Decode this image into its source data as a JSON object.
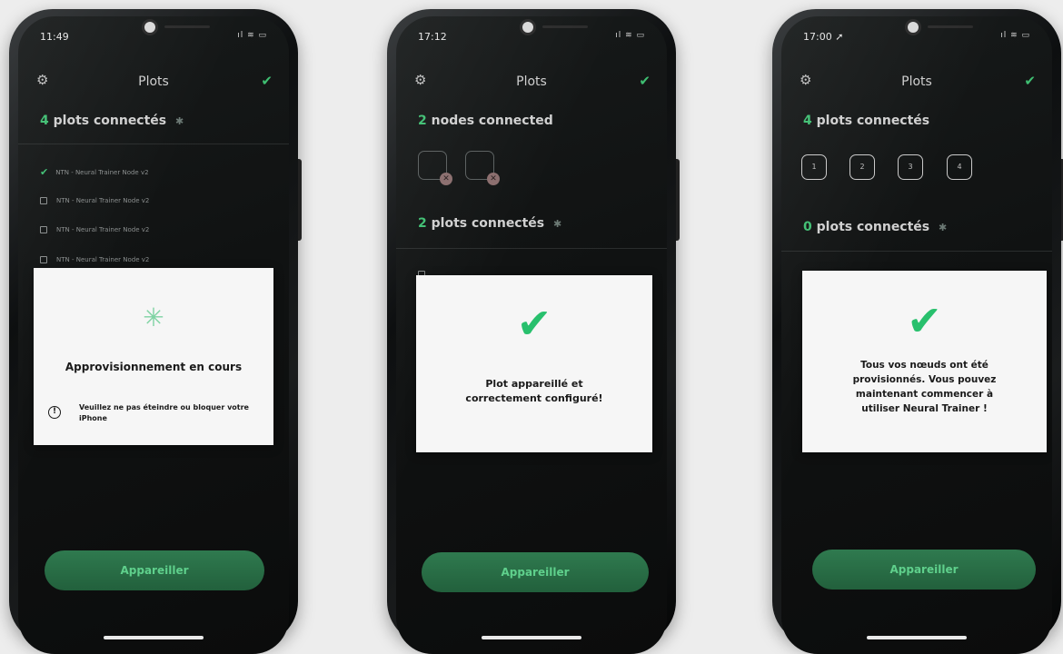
{
  "phones": [
    {
      "time": "11:49",
      "status_icons": "ıl ≋ ▭",
      "nav": {
        "title": "Plots"
      },
      "section1": {
        "count": "4",
        "label": "plots connectés"
      },
      "items": [
        "NTN - Neural Trainer Node v2",
        "NTN - Neural Trainer Node v2",
        "NTN - Neural Trainer Node v2",
        "NTN - Neural Trainer Node v2"
      ],
      "modal": {
        "title": "Approvisionnement en cours",
        "warning": "Veuillez ne pas éteindre ou bloquer votre iPhone"
      },
      "pair_button": "Appareiller"
    },
    {
      "time": "17:12",
      "status_icons": "ıl ≋ ▭",
      "nav": {
        "title": "Plots"
      },
      "section1": {
        "count": "2",
        "label": "nodes connected"
      },
      "section2": {
        "count": "2",
        "label": "plots connectés"
      },
      "modal": {
        "message_line1": "Plot appareillé et",
        "message_line2": "correctement configuré!"
      },
      "pair_button": "Appareiller"
    },
    {
      "time": "17:00 ➚",
      "status_icons": "ıl ≋ ▭",
      "nav": {
        "title": "Plots"
      },
      "section1": {
        "count": "4",
        "label": "plots connectés"
      },
      "slots": [
        "1",
        "2",
        "3",
        "4"
      ],
      "section2": {
        "count": "0",
        "label": "plots connectés"
      },
      "modal": {
        "lines": [
          "Tous vos nœuds ont été",
          "provisionnés. Vous pouvez",
          "maintenant commencer à",
          "utiliser Neural Trainer !"
        ]
      },
      "pair_button": "Appareiller"
    }
  ],
  "colors": {
    "accent": "#3fbf72",
    "button": "#2a6e46",
    "modal_bg": "#f6f6f6",
    "screen_bg": "#121414"
  }
}
